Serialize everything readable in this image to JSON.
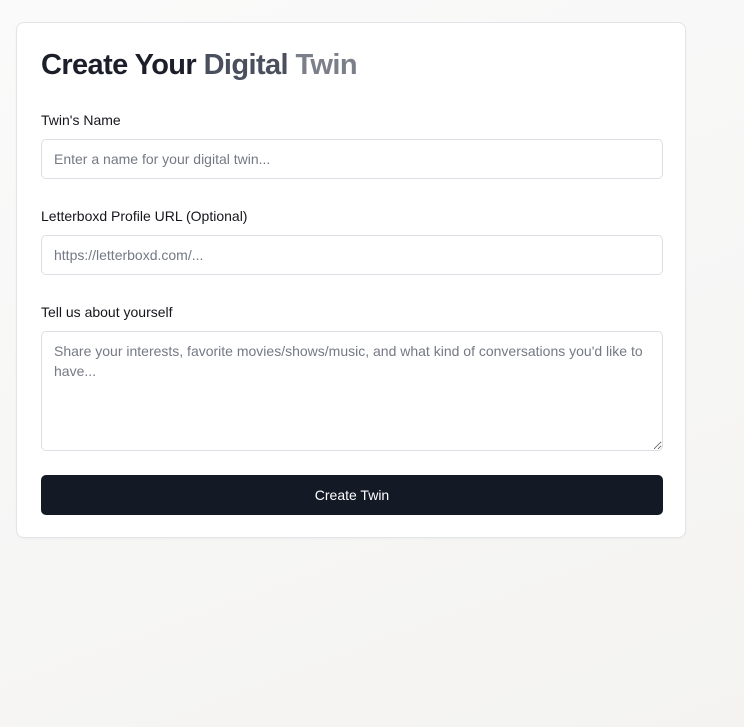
{
  "form": {
    "title_part1": "Create Your ",
    "title_part2": "Digital",
    "title_part3": " Twin",
    "name_label": "Twin's Name",
    "name_placeholder": "Enter a name for your digital twin...",
    "name_value": "",
    "letterboxd_label": "Letterboxd Profile URL (Optional)",
    "letterboxd_placeholder": "https://letterboxd.com/...",
    "letterboxd_value": "",
    "about_label": "Tell us about yourself",
    "about_placeholder": "Share your interests, favorite movies/shows/music, and what kind of conversations you'd like to have...",
    "about_value": "",
    "submit_label": "Create Twin"
  },
  "colors": {
    "page_background": "#f6f6f5",
    "card_background": "#ffffff",
    "button_background": "#141926",
    "button_text": "#ffffff",
    "title_dark": "#1c1f2a",
    "title_mid": "#4a4f5e",
    "title_light": "#7b7f8a"
  }
}
